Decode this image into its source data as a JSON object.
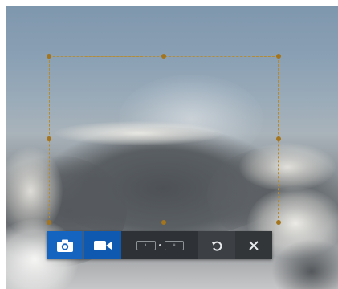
{
  "capture_toolbar": {
    "buttons": [
      {
        "id": "screenshot",
        "icon": "camera-icon"
      },
      {
        "id": "record-video",
        "icon": "video-camera-icon"
      },
      {
        "id": "resolution-toggle",
        "icon": "resolution-icon"
      },
      {
        "id": "reset",
        "icon": "undo-icon"
      },
      {
        "id": "close",
        "icon": "close-icon"
      }
    ],
    "resolution_left": "↓",
    "resolution_right": "≡"
  },
  "colors": {
    "accent_blue": "#1565c0",
    "toolbar_dark": "#3c3f43",
    "selection_border": "#b88a2a"
  }
}
